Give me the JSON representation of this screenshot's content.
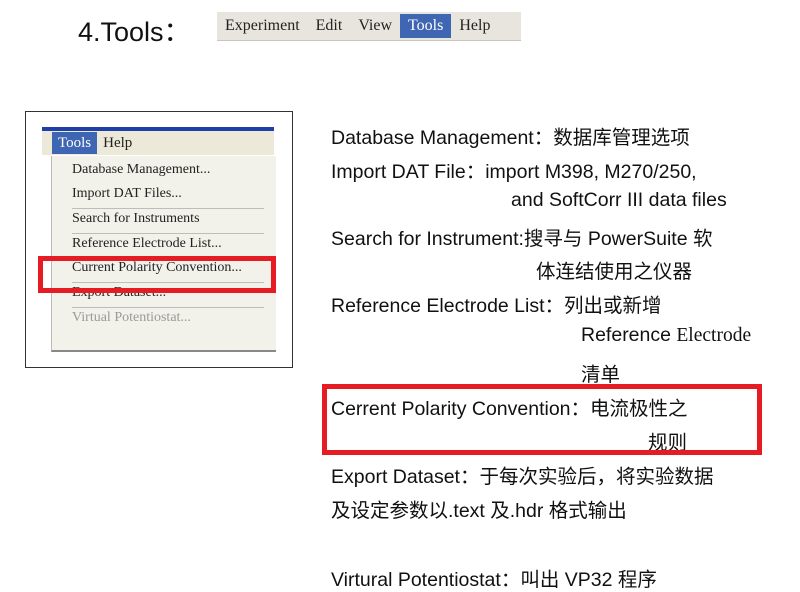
{
  "heading": "4.Tools：",
  "top_menubar": {
    "items": [
      "Experiment",
      "Edit",
      "View",
      "Tools",
      "Help"
    ],
    "active": "Tools"
  },
  "screenshot": {
    "menubar": [
      "Tools",
      "Help"
    ],
    "items": [
      "Database Management...",
      "Import DAT Files...",
      "Search for Instruments",
      "Reference Electrode List...",
      "Current Polarity Convention...",
      "Export Dataset...",
      "Virtual Potentiostat..."
    ],
    "disabled_item": "Virtual Potentiostat..."
  },
  "descriptions": [
    "Database Management：数据库管理选项",
    "Import DAT File：import M398, M270/250,",
    "and SoftCorr III data files",
    "Search for Instrument:搜寻与  PowerSuite  软",
    "体连结使用之仪器",
    "Reference Electrode List：列出或新增",
    "Reference",
    "Electrode",
    "清单",
    "Cerrent Polarity Convention：电流极性之",
    "规则",
    "Export Dataset：于每次实验后，将实验数据",
    "及设定参数以.text  及.hdr  格式输出",
    "Virtural Potentiostat：叫出  VP32  程序"
  ],
  "colors": {
    "highlight_red": "#e51c23",
    "menu_active_blue": "#3f66b3"
  }
}
